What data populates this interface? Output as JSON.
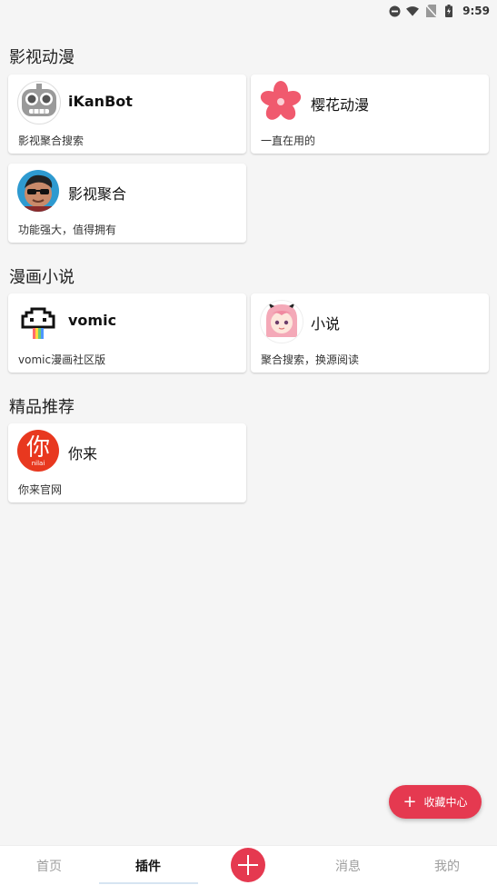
{
  "status_bar": {
    "time": "9:59",
    "icons": [
      "do-not-disturb-icon",
      "wifi-icon",
      "no-sim-icon",
      "battery-charging-icon"
    ]
  },
  "sections": [
    {
      "title": "影视动漫",
      "cards": [
        {
          "name": "iKanBot",
          "desc": "影视聚合搜索",
          "icon": "robot-icon"
        },
        {
          "name": "樱花动漫",
          "desc": "一直在用的",
          "icon": "sakura-flower-icon"
        },
        {
          "name": "影视聚合",
          "desc": "功能强大，值得拥有",
          "icon": "sunglasses-man-avatar"
        }
      ]
    },
    {
      "title": "漫画小说",
      "cards": [
        {
          "name": "vomic",
          "desc": "vomic漫画社区版",
          "icon": "pixel-cloud-rainbow-icon"
        },
        {
          "name": "小说",
          "desc": "聚合搜索，换源阅读",
          "icon": "anime-girl-avatar"
        }
      ]
    },
    {
      "title": "精品推荐",
      "cards": [
        {
          "name": "你来",
          "desc": "你来官网",
          "icon": "nilai-logo",
          "logo_text": "你",
          "logo_subtext": "nilai"
        }
      ]
    }
  ],
  "fab": {
    "label": "收藏中心",
    "icon": "plus-icon"
  },
  "bottom_nav": {
    "items": [
      {
        "label": "首页",
        "active": false
      },
      {
        "label": "插件",
        "active": true
      },
      {
        "label": "",
        "icon": "add-circle-icon"
      },
      {
        "label": "消息",
        "active": false
      },
      {
        "label": "我的",
        "active": false
      }
    ]
  },
  "colors": {
    "accent": "#e53950",
    "background": "#f5f5f5",
    "card": "#ffffff",
    "nav_inactive": "#9e9e9e"
  }
}
